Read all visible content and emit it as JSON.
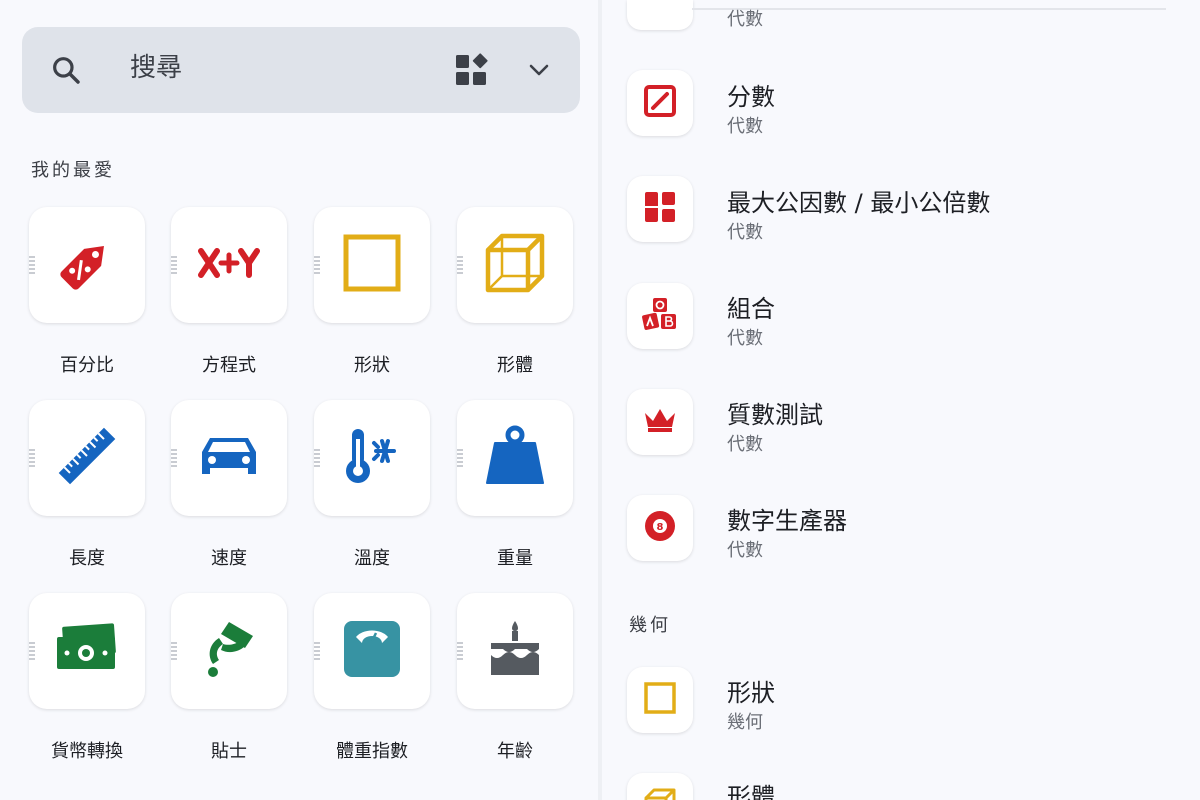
{
  "search": {
    "placeholder": "搜尋",
    "search_icon": "search-icon",
    "grid_icon": "category-grid-icon",
    "expand_icon": "chevron-down-icon"
  },
  "favorites": {
    "title": "我的最愛",
    "items": [
      {
        "label": "百分比",
        "icon": "percent-tag-icon",
        "color": "#d32027"
      },
      {
        "label": "方程式",
        "icon": "x-plus-y-icon",
        "color": "#d32027"
      },
      {
        "label": "形狀",
        "icon": "square-icon",
        "color": "#e2ad17"
      },
      {
        "label": "形體",
        "icon": "cube-icon",
        "color": "#e2ad17"
      },
      {
        "label": "長度",
        "icon": "ruler-icon",
        "color": "#1565c0"
      },
      {
        "label": "速度",
        "icon": "car-icon",
        "color": "#1565c0"
      },
      {
        "label": "溫度",
        "icon": "thermometer-snow-icon",
        "color": "#1565c0"
      },
      {
        "label": "重量",
        "icon": "weight-icon",
        "color": "#1565c0"
      },
      {
        "label": "貨幣轉換",
        "icon": "banknote-icon",
        "color": "#1b7d3a"
      },
      {
        "label": "貼士",
        "icon": "tip-hand-icon",
        "color": "#1b7d3a"
      },
      {
        "label": "體重指數",
        "icon": "scale-icon",
        "color": "#3793a3"
      },
      {
        "label": "年齡",
        "icon": "birthday-cake-icon",
        "color": "#555a60"
      }
    ]
  },
  "list": {
    "top_partial_sub": "代數",
    "algebra_items": [
      {
        "title": "分數",
        "sub": "代數",
        "icon": "fraction-icon"
      },
      {
        "title": "最大公因數 / 最小公倍數",
        "sub": "代數",
        "icon": "blocks-icon"
      },
      {
        "title": "組合",
        "sub": "代數",
        "icon": "abc-blocks-icon"
      },
      {
        "title": "質數測試",
        "sub": "代數",
        "icon": "crown-icon"
      },
      {
        "title": "數字生產器",
        "sub": "代數",
        "icon": "eight-ball-icon"
      }
    ],
    "geometry_header": "幾何",
    "geometry_items": [
      {
        "title": "形狀",
        "sub": "幾何",
        "icon": "square-icon"
      },
      {
        "title": "形體",
        "sub": "",
        "icon": "cube-icon"
      }
    ]
  },
  "colors": {
    "red": "#d32027",
    "yellow": "#e2ad17",
    "blue": "#1565c0",
    "green": "#1b7d3a",
    "teal": "#3793a3",
    "gray": "#555a60"
  }
}
